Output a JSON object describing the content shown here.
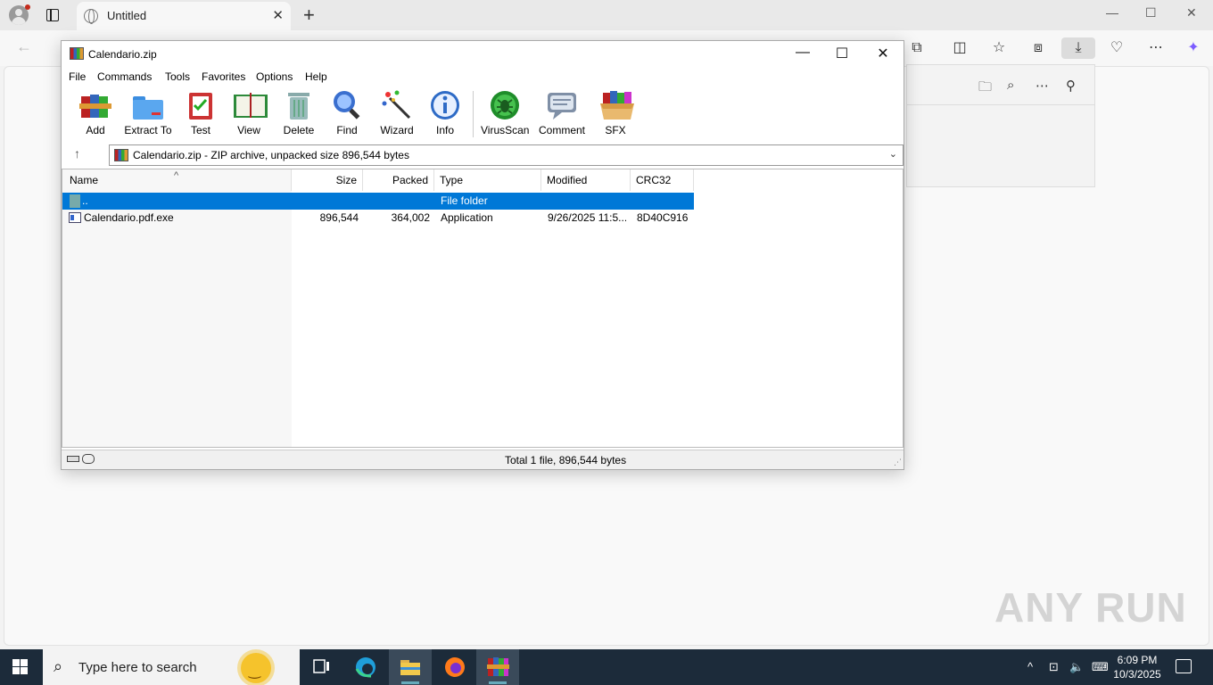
{
  "browser": {
    "tab_title": "Untitled",
    "tab_close": "✕",
    "new_tab": "+",
    "window_controls": [
      "—",
      "☐",
      "✕"
    ],
    "back": "←",
    "toolbar_icons": [
      "extensions-icon",
      "split-screen-icon",
      "favorites-icon",
      "collections-icon",
      "downloads-icon",
      "browser-essentials-icon",
      "more-icon",
      "copilot-icon"
    ],
    "downloads_panel_icons": [
      "open-folder-icon",
      "search-icon",
      "more-icon",
      "pin-icon"
    ]
  },
  "watermark": "ANY RUN",
  "winrar": {
    "title": "Calendario.zip",
    "menu": [
      "File",
      "Commands",
      "Tools",
      "Favorites",
      "Options",
      "Help"
    ],
    "tools": [
      "Add",
      "Extract To",
      "Test",
      "View",
      "Delete",
      "Find",
      "Wizard",
      "Info",
      "VirusScan",
      "Comment",
      "SFX"
    ],
    "address": "Calendario.zip - ZIP archive, unpacked size 896,544 bytes",
    "columns": [
      "Name",
      "Size",
      "Packed",
      "Type",
      "Modified",
      "CRC32"
    ],
    "rows": [
      {
        "name": "..",
        "size": "",
        "packed": "",
        "type": "File folder",
        "modified": "",
        "crc": ""
      },
      {
        "name": "Calendario.pdf.exe",
        "size": "896,544",
        "packed": "364,002",
        "type": "Application",
        "modified": "9/26/2025 11:5...",
        "crc": "8D40C916"
      }
    ],
    "status": "Total 1 file, 896,544 bytes"
  },
  "taskbar": {
    "search_placeholder": "Type here to search",
    "time": "6:09 PM",
    "date": "10/3/2025"
  }
}
